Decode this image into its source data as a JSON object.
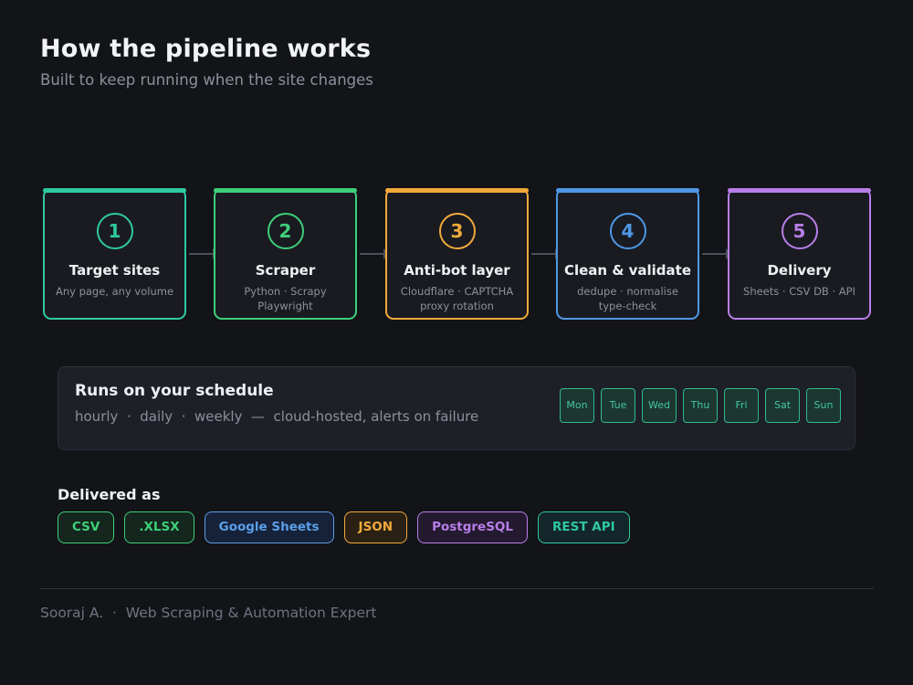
{
  "header": {
    "title": "How the pipeline works",
    "subtitle": "Built to keep running when the site changes"
  },
  "pipeline": {
    "steps": [
      {
        "number": "1",
        "name": "Target sites",
        "desc": "Any page, any volume",
        "color": "#2fc9a0"
      },
      {
        "number": "2",
        "name": "Scraper",
        "desc": "Python · Scrapy Playwright",
        "color": "#3ecf7a"
      },
      {
        "number": "3",
        "name": "Anti-bot layer",
        "desc": "Cloudflare · CAPTCHA proxy rotation",
        "color": "#f2a93b"
      },
      {
        "number": "4",
        "name": "Clean & validate",
        "desc": "dedupe · normalise type-check",
        "color": "#4f97e6"
      },
      {
        "number": "5",
        "name": "Delivery",
        "desc": "Sheets · CSV DB · API",
        "color": "#b87ee8"
      }
    ]
  },
  "schedule": {
    "title": "Runs on your schedule",
    "frequencies": "hourly  ·  daily  ·  weekly  —  cloud-hosted, alerts on failure",
    "days": [
      "Mon",
      "Tue",
      "Wed",
      "Thu",
      "Fri",
      "Sat",
      "Sun"
    ]
  },
  "delivered": {
    "label": "Delivered as",
    "formats": [
      {
        "label": "CSV",
        "color": "#3ecf7a",
        "bg": "#14261d"
      },
      {
        "label": ".XLSX",
        "color": "#3ecf7a",
        "bg": "#14261d"
      },
      {
        "label": "Google Sheets",
        "color": "#5a9fe8",
        "bg": "#16223a"
      },
      {
        "label": "JSON",
        "color": "#f2a93b",
        "bg": "#2a2114"
      },
      {
        "label": "PostgreSQL",
        "color": "#b87ee8",
        "bg": "#241a30"
      },
      {
        "label": "REST API",
        "color": "#2fc9a0",
        "bg": "#13262a"
      }
    ]
  },
  "footer": {
    "text": "Sooraj A.  ·  Web Scraping & Automation Expert"
  }
}
